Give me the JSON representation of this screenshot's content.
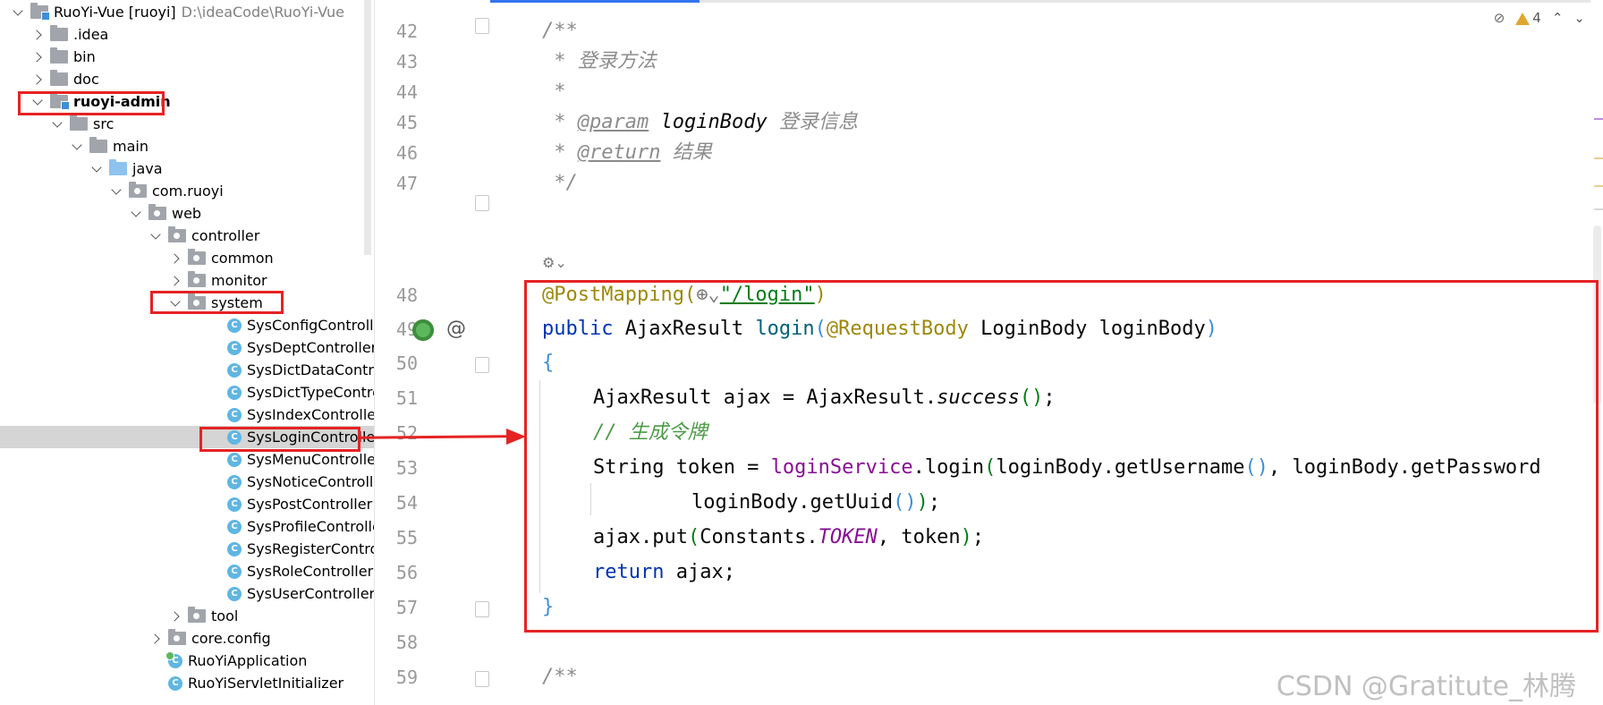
{
  "project_tree": {
    "items": [
      {
        "label": "RuoYi-Vue [ruoyi]",
        "suffix": "D:\\ideaCode\\RuoYi-Vue",
        "icon": "module-folder-icon",
        "chevron": "down",
        "bold": false
      },
      {
        "label": ".idea",
        "icon": "folder-icon",
        "chevron": "right"
      },
      {
        "label": "bin",
        "icon": "folder-icon",
        "chevron": "right"
      },
      {
        "label": "doc",
        "icon": "folder-icon",
        "chevron": "right"
      },
      {
        "label": "ruoyi-admin",
        "icon": "module-folder-icon",
        "chevron": "down",
        "bold": true
      },
      {
        "label": "src",
        "icon": "folder-icon",
        "chevron": "down"
      },
      {
        "label": "main",
        "icon": "folder-icon",
        "chevron": "down"
      },
      {
        "label": "java",
        "icon": "source-folder-icon",
        "chevron": "down"
      },
      {
        "label": "com.ruoyi",
        "icon": "package-icon",
        "chevron": "down"
      },
      {
        "label": "web",
        "icon": "package-icon",
        "chevron": "down"
      },
      {
        "label": "controller",
        "icon": "package-icon",
        "chevron": "down"
      },
      {
        "label": "common",
        "icon": "package-icon",
        "chevron": "right"
      },
      {
        "label": "monitor",
        "icon": "package-icon",
        "chevron": "right"
      },
      {
        "label": "system",
        "icon": "package-icon",
        "chevron": "down"
      },
      {
        "label": "SysConfigController",
        "icon": "class-icon"
      },
      {
        "label": "SysDeptController",
        "icon": "class-icon"
      },
      {
        "label": "SysDictDataController",
        "icon": "class-icon"
      },
      {
        "label": "SysDictTypeController",
        "icon": "class-icon"
      },
      {
        "label": "SysIndexController",
        "icon": "class-icon"
      },
      {
        "label": "SysLoginController",
        "icon": "class-icon",
        "selected": true
      },
      {
        "label": "SysMenuController",
        "icon": "class-icon"
      },
      {
        "label": "SysNoticeController",
        "icon": "class-icon"
      },
      {
        "label": "SysPostController",
        "icon": "class-icon"
      },
      {
        "label": "SysProfileController",
        "icon": "class-icon"
      },
      {
        "label": "SysRegisterController",
        "icon": "class-icon"
      },
      {
        "label": "SysRoleController",
        "icon": "class-icon"
      },
      {
        "label": "SysUserController",
        "icon": "class-icon"
      },
      {
        "label": "tool",
        "icon": "package-icon",
        "chevron": "right"
      },
      {
        "label": "core.config",
        "icon": "package-icon",
        "chevron": "right"
      },
      {
        "label": "RuoYiApplication",
        "icon": "spring-class-icon"
      },
      {
        "label": "RuoYiServletInitializer",
        "icon": "class-icon"
      }
    ]
  },
  "editor": {
    "line_numbers": [
      "42",
      "43",
      "44",
      "45",
      "46",
      "47",
      "48",
      "49",
      "50",
      "51",
      "52",
      "53",
      "54",
      "55",
      "56",
      "57",
      "58",
      "59"
    ],
    "code": {
      "l42": "/**",
      "l43_star": " * ",
      "l43_text": "登录方法",
      "l44": " *",
      "l45_star": " * ",
      "l45_tag": "@param",
      "l45_name": " loginBody ",
      "l45_text": "登录信息",
      "l46_star": " * ",
      "l46_tag": "@return",
      "l46_text": " 结果",
      "l47": " */",
      "l48_ann": "@PostMapping(",
      "l48_str": "\"/login\"",
      "l48_close": ")",
      "l49_kw": "public",
      "l49_type": " AjaxResult ",
      "l49_method": "login",
      "l49_p1": "(",
      "l49_ann": "@RequestBody",
      "l49_rest": " LoginBody loginBody",
      "l49_p2": ")",
      "l50": "{",
      "l51_a": "AjaxResult ajax = AjaxResult.",
      "l51_m": "success",
      "l51_p": "()",
      "l51_end": ";",
      "l52": "// 生成令牌",
      "l53_a": "String token = ",
      "l53_f": "loginService",
      "l53_b": ".login",
      "l53_p1": "(",
      "l53_c": "loginBody.getUsername",
      "l53_p2": "()",
      "l53_d": ", loginBody.getPassword",
      "l54_a": "loginBody.getUuid",
      "l54_p": "()",
      "l54_p2": ")",
      "l54_end": ";",
      "l55_a": "ajax.put",
      "l55_p1": "(",
      "l55_b": "Constants.",
      "l55_c": "TOKEN",
      "l55_d": ", token",
      "l55_p2": ")",
      "l55_end": ";",
      "l56_kw": "return",
      "l56_rest": " ajax;",
      "l57": "}",
      "l59": "/**"
    }
  },
  "status": {
    "warning_count": "4"
  },
  "watermark": "CSDN @Gratitute_林腾",
  "colors": {
    "highlight_box": "#e52323",
    "selection": "#d5d5d5"
  }
}
